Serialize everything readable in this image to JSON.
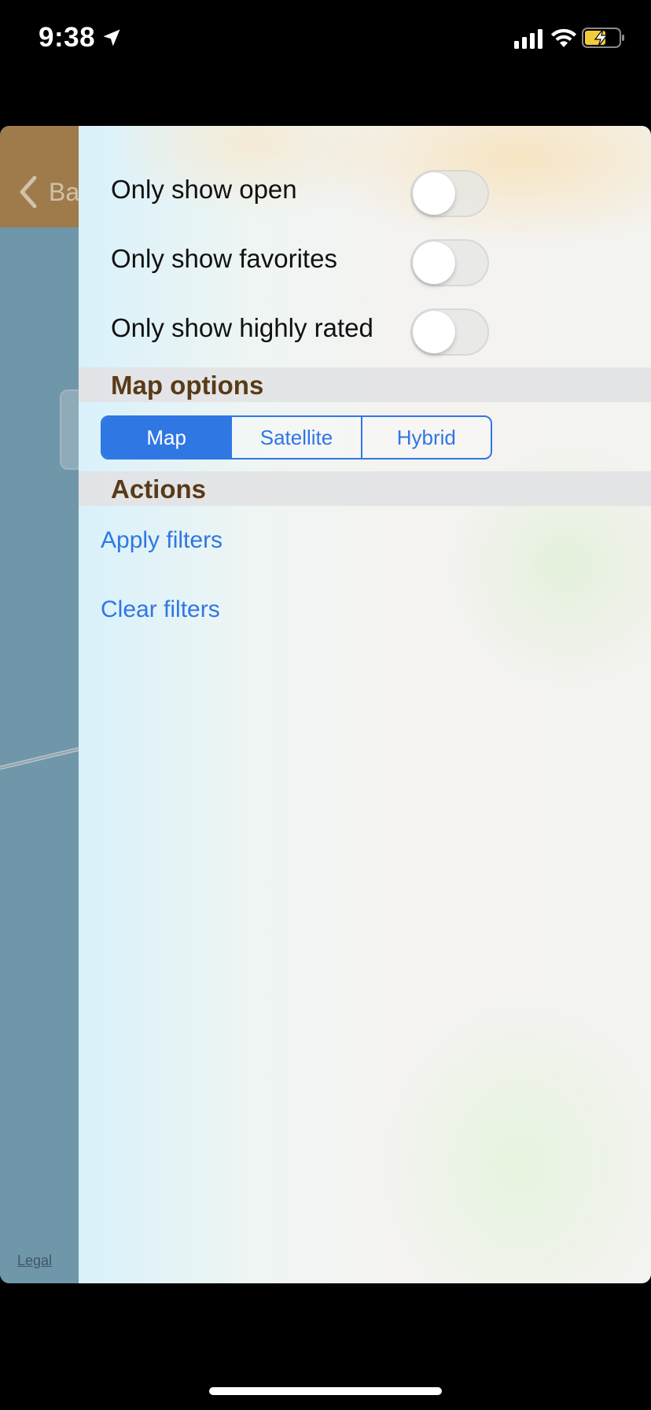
{
  "status_bar": {
    "time": "9:38",
    "location_icon": "location-arrow-icon",
    "signal_icon": "cellular-signal-icon",
    "wifi_icon": "wifi-icon",
    "battery_icon": "battery-charging-icon"
  },
  "background_view": {
    "back_label": "Ba",
    "legal_label": "Legal"
  },
  "filters": [
    {
      "label": "Only show open",
      "on": false
    },
    {
      "label": "Only show favorites",
      "on": false
    },
    {
      "label": "Only show highly rated",
      "on": false
    }
  ],
  "map_options": {
    "title": "Map options",
    "segments": [
      "Map",
      "Satellite",
      "Hybrid"
    ],
    "selected": "Map"
  },
  "actions": {
    "title": "Actions",
    "apply_label": "Apply filters",
    "clear_label": "Clear filters"
  },
  "colors": {
    "accent": "#2f77e3",
    "section_title": "#5a3a17",
    "nav_bar": "#9f7b4b",
    "map_water": "#7096a9"
  }
}
